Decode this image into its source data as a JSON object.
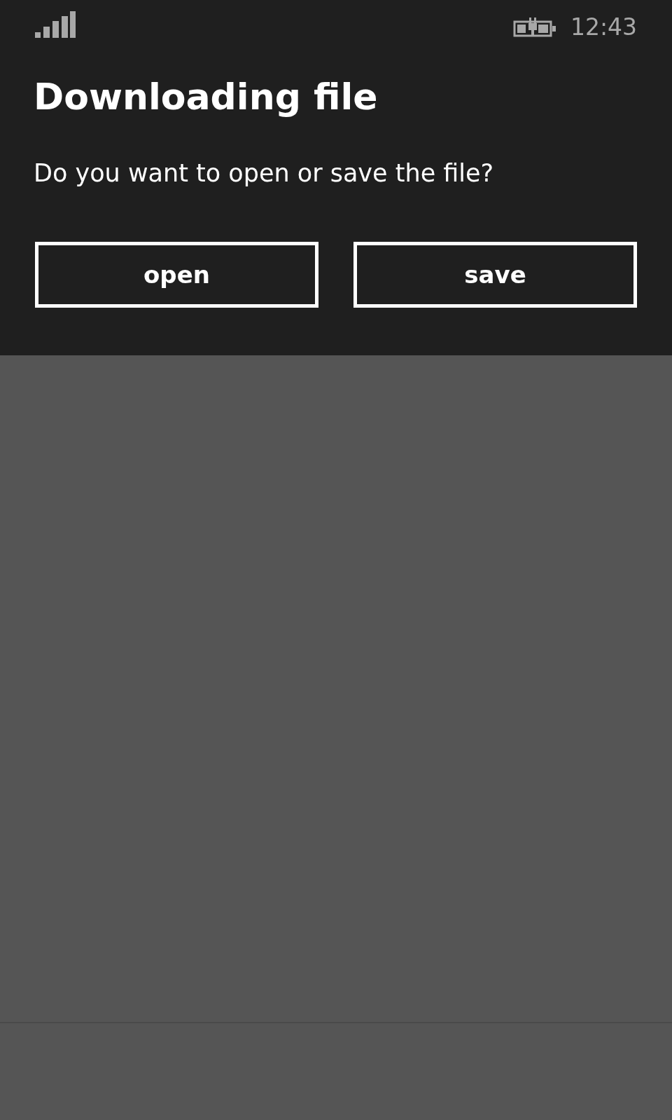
{
  "status_bar": {
    "time": "12:43"
  },
  "dialog": {
    "title": "Downloading file",
    "message": "Do you want to open or save the file?",
    "buttons": [
      {
        "label": "open"
      },
      {
        "label": "save"
      }
    ]
  }
}
